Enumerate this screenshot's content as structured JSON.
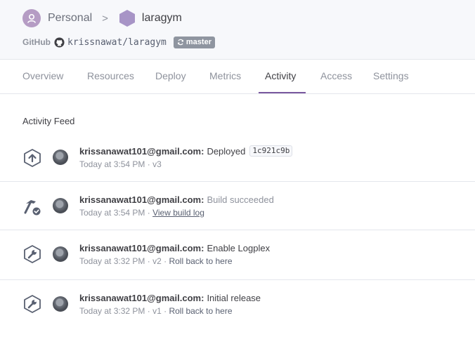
{
  "header": {
    "breadcrumb": {
      "personal": "Personal",
      "separator": ">",
      "app": "laragym"
    },
    "github_label": "GitHub",
    "repo": "krissnawat/laragym",
    "branch": "master"
  },
  "tabs": [
    "Overview",
    "Resources",
    "Deploy",
    "Metrics",
    "Activity",
    "Access",
    "Settings"
  ],
  "active_tab": "Activity",
  "feed": {
    "title": "Activity Feed",
    "items": [
      {
        "icon": "deploy-icon",
        "email": "krissanawat101@gmail.com:",
        "action": "Deployed",
        "commit": "1c921c9b",
        "time": "Today at 3:54 PM",
        "separator": "·",
        "version": "v3"
      },
      {
        "icon": "build-icon",
        "email": "krissanawat101@gmail.com:",
        "action": "Build succeeded",
        "time": "Today at 3:54 PM",
        "separator": "·",
        "link": "View build log"
      },
      {
        "icon": "wrench-icon",
        "email": "krissanawat101@gmail.com:",
        "action": "Enable Logplex",
        "time": "Today at 3:32 PM",
        "separator": "·",
        "version": "v2",
        "separator2": "·",
        "link": "Roll back to here"
      },
      {
        "icon": "wrench-icon",
        "email": "krissanawat101@gmail.com:",
        "action": "Initial release",
        "time": "Today at 3:32 PM",
        "separator": "·",
        "version": "v1",
        "separator2": "·",
        "link": "Roll back to here"
      }
    ]
  },
  "colors": {
    "accent": "#79589f",
    "muted_text": "#8e929c",
    "primary_text": "#3f3f44",
    "header_bg": "#f7f8fb",
    "branch_badge": "#8f95a0"
  }
}
